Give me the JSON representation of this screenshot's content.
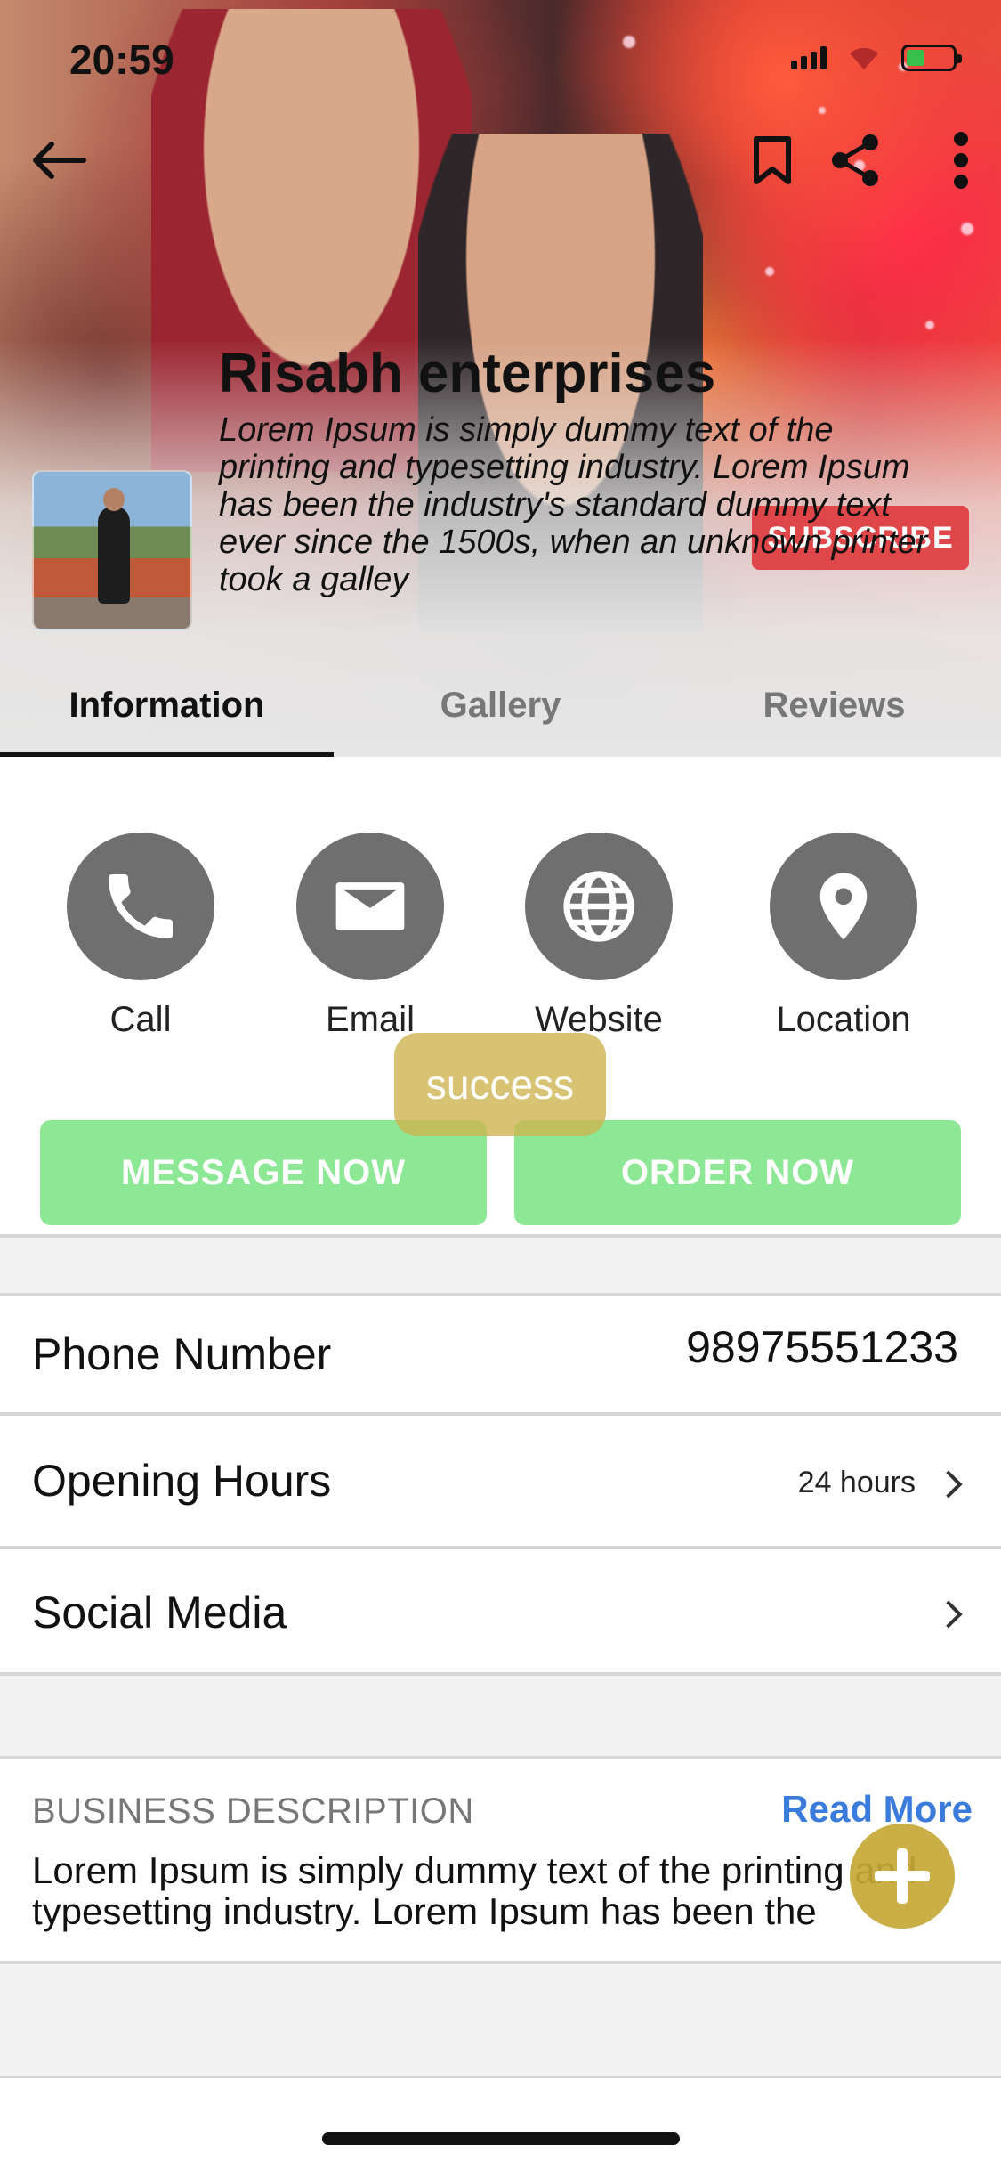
{
  "status_bar": {
    "time": "20:59"
  },
  "header": {
    "title": "Risabh enterprises",
    "description": "Lorem Ipsum is simply dummy text of the printing and typesetting industry. Lorem Ipsum has been the industry's standard dummy text ever since the 1500s, when an unknown printer took a galley",
    "subscribe_label": "SUBSCRIBE",
    "icons": [
      "back-arrow-icon",
      "bookmark-icon",
      "share-icon",
      "more-vertical-icon"
    ]
  },
  "tabs": [
    {
      "label": "Information",
      "active": true
    },
    {
      "label": "Gallery",
      "active": false
    },
    {
      "label": "Reviews",
      "active": false
    }
  ],
  "actions": [
    {
      "label": "Call",
      "icon": "phone-icon"
    },
    {
      "label": "Email",
      "icon": "mail-icon"
    },
    {
      "label": "Website",
      "icon": "globe-icon"
    },
    {
      "label": "Location",
      "icon": "location-pin-icon"
    }
  ],
  "toast": {
    "text": "success"
  },
  "buttons": {
    "message_now": "MESSAGE NOW",
    "order_now": "ORDER NOW"
  },
  "info": {
    "phone_label": "Phone Number",
    "phone_value": "98975551233",
    "hours_label": "Opening Hours",
    "hours_value": "24 hours",
    "social_label": "Social Media"
  },
  "business_description": {
    "heading": "BUSINESS DESCRIPTION",
    "read_more": "Read More",
    "text": "Lorem Ipsum is simply dummy text of the printing and typesetting industry. Lorem Ipsum has been the industry's standard"
  },
  "colors": {
    "cta_green": "#8ce895",
    "subscribe_red": "#de3034",
    "toast_gold": "#cdb450",
    "fab_gold": "#c4a836",
    "link_blue": "#3a7bdc",
    "icon_gray": "#6f6f6f"
  }
}
